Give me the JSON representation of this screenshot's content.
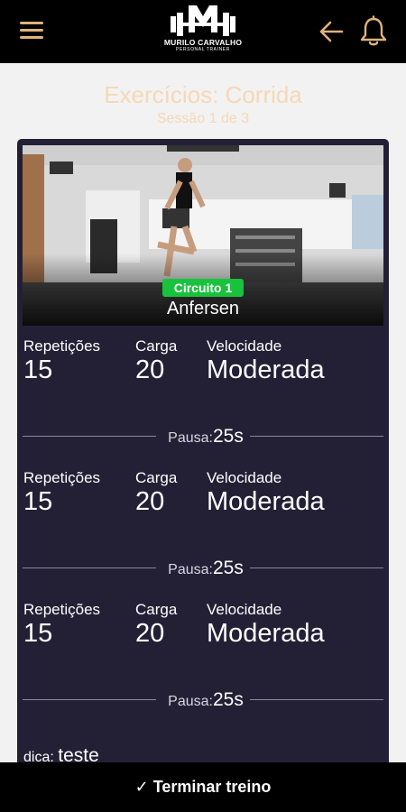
{
  "header": {
    "brand_name": "MURILO CARVALHO",
    "brand_tagline": "PERSONAL TRAINER",
    "logo_letter": "M",
    "icons": [
      "menu-icon",
      "arrow-left-icon",
      "bell-icon"
    ],
    "accent_color": "#e0b37a"
  },
  "page": {
    "title": "Exercícios: Corrida",
    "subtitle": "Sessão 1 de 3",
    "title_color": "#f6d8b5"
  },
  "exercise": {
    "circuit_label": "Circuito 1",
    "name": "Anfersen",
    "badge_color": "#19c23d",
    "card_color": "#232036",
    "sets": [
      {
        "reps_label": "Repetições",
        "reps": "15",
        "load_label": "Carga",
        "load": "20",
        "speed_label": "Velocidade",
        "speed": "Moderada"
      },
      {
        "reps_label": "Repetições",
        "reps": "15",
        "load_label": "Carga",
        "load": "20",
        "speed_label": "Velocidade",
        "speed": "Moderada"
      },
      {
        "reps_label": "Repetições",
        "reps": "15",
        "load_label": "Carga",
        "load": "20",
        "speed_label": "Velocidade",
        "speed": "Moderada"
      }
    ],
    "pauses": [
      {
        "label": "Pausa:",
        "value": "25s"
      },
      {
        "label": "Pausa:",
        "value": "25s"
      },
      {
        "label": "Pausa:",
        "value": "25s"
      }
    ],
    "tip_label": "dica:",
    "tip_value": "teste"
  },
  "footer": {
    "finish_label": "✓ Terminar treino"
  }
}
